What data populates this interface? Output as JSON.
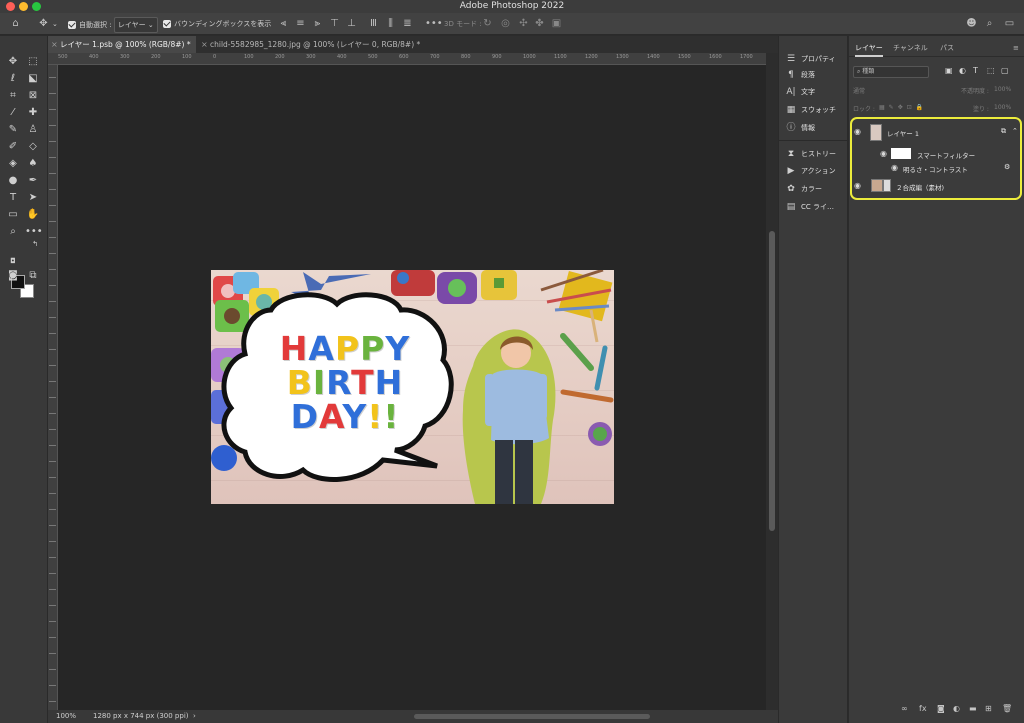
{
  "window": {
    "title": "Adobe Photoshop 2022"
  },
  "options_bar": {
    "auto_select_label": "自動選択 :",
    "auto_select_value": "レイヤー",
    "bbox_label": "バウンディングボックスを表示",
    "mode_3d_label": "3D モード :"
  },
  "tabs": [
    {
      "label": "レイヤー 1.psb @ 100% (RGB/8#) *"
    },
    {
      "label": "child-5582985_1280.jpg @ 100% (レイヤー 0, RGB/8#) *"
    }
  ],
  "ruler": {
    "ticks": [
      "500",
      "400",
      "300",
      "200",
      "100",
      "0",
      "100",
      "200",
      "300",
      "400",
      "500",
      "600",
      "700",
      "800",
      "900",
      "1000",
      "1100",
      "1200",
      "1300",
      "1400",
      "1500",
      "1600",
      "1700"
    ]
  },
  "artwork": {
    "line1": "HAPPY",
    "line2": "BIRTH",
    "line3": "DAY!!",
    "colors": {
      "red": "#e23a3a",
      "blue": "#2f6fd9",
      "green": "#6ab33e",
      "yellow": "#f2c31b"
    }
  },
  "status": {
    "zoom": "100%",
    "doc_info": "1280 px x 744 px (300 ppi)"
  },
  "dock": {
    "items": [
      {
        "label": "プロパティ",
        "icon": "properties-icon"
      },
      {
        "label": "段落",
        "icon": "paragraph-icon"
      },
      {
        "label": "文字",
        "icon": "character-icon"
      },
      {
        "label": "スウォッチ",
        "icon": "swatches-icon"
      },
      {
        "label": "情報",
        "icon": "info-icon"
      },
      {
        "label": "ヒストリー",
        "icon": "history-icon"
      },
      {
        "label": "アクション",
        "icon": "actions-icon"
      },
      {
        "label": "カラー",
        "icon": "color-icon"
      },
      {
        "label": "CC ライ…",
        "icon": "cc-libraries-icon"
      }
    ]
  },
  "layers_panel": {
    "tabs": [
      "レイヤー",
      "チャンネル",
      "パス"
    ],
    "filter_kind": "種類",
    "blend_mode": "通常",
    "opacity_label": "不透明度 :",
    "opacity_value": "100%",
    "lock_label": "ロック :",
    "fill_label": "塗り :",
    "fill_value": "100%",
    "layers": [
      {
        "name": "レイヤー 1",
        "smart_filter": "スマートフィルター",
        "filter": "明るさ・コントラスト"
      },
      {
        "name": "２合成編（素材)"
      }
    ],
    "highlight_color": "#ecec3c"
  }
}
